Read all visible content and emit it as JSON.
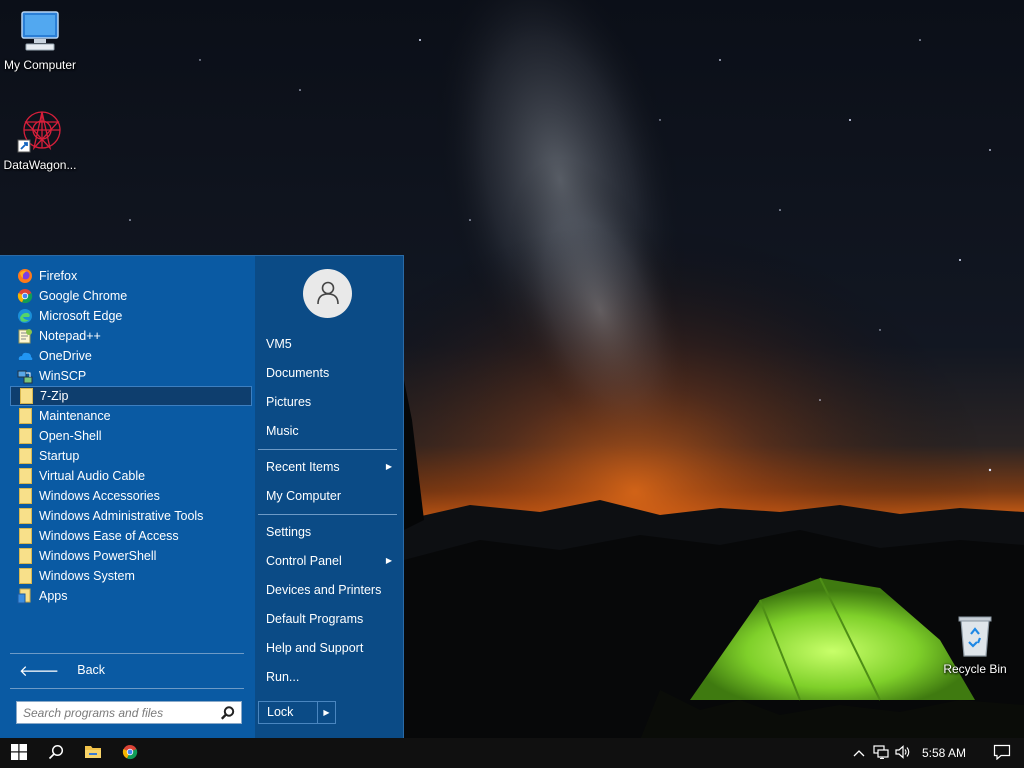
{
  "desktop": {
    "icons": [
      {
        "label": "My Computer",
        "icon": "computer-icon"
      },
      {
        "label": "DataWagon...",
        "icon": "datawagon-shortcut-icon"
      },
      {
        "label": "Recycle Bin",
        "icon": "recycle-bin-icon"
      }
    ]
  },
  "start_menu": {
    "programs": [
      {
        "label": "Firefox",
        "icon": "firefox-icon"
      },
      {
        "label": "Google Chrome",
        "icon": "chrome-icon"
      },
      {
        "label": "Microsoft Edge",
        "icon": "edge-icon"
      },
      {
        "label": "Notepad++",
        "icon": "notepadpp-icon"
      },
      {
        "label": "OneDrive",
        "icon": "onedrive-icon"
      },
      {
        "label": "WinSCP",
        "icon": "winscp-icon"
      },
      {
        "label": "7-Zip",
        "icon": "folder-icon",
        "selected": true
      },
      {
        "label": "Maintenance",
        "icon": "folder-icon"
      },
      {
        "label": "Open-Shell",
        "icon": "folder-icon"
      },
      {
        "label": "Startup",
        "icon": "folder-icon"
      },
      {
        "label": "Virtual Audio Cable",
        "icon": "folder-icon"
      },
      {
        "label": "Windows Accessories",
        "icon": "folder-icon"
      },
      {
        "label": "Windows Administrative Tools",
        "icon": "folder-icon"
      },
      {
        "label": "Windows Ease of Access",
        "icon": "folder-icon"
      },
      {
        "label": "Windows PowerShell",
        "icon": "folder-icon"
      },
      {
        "label": "Windows System",
        "icon": "folder-icon"
      },
      {
        "label": "Apps",
        "icon": "apps-icon"
      }
    ],
    "back_label": "Back",
    "search_placeholder": "Search programs and files",
    "places": [
      {
        "label": "VM5"
      },
      {
        "label": "Documents"
      },
      {
        "label": "Pictures"
      },
      {
        "label": "Music"
      },
      {
        "label": "Recent Items",
        "submenu": true
      },
      {
        "label": "My Computer"
      },
      {
        "label": "Settings"
      },
      {
        "label": "Control Panel",
        "submenu": true
      },
      {
        "label": "Devices and Printers"
      },
      {
        "label": "Default Programs"
      },
      {
        "label": "Help and Support"
      },
      {
        "label": "Run..."
      }
    ],
    "lock_label": "Lock",
    "arrow_glyph": "▶",
    "back_glyph": "🡐"
  },
  "taskbar": {
    "clock": "5:58 AM"
  },
  "colors": {
    "menu_left": "#0a5aa3",
    "menu_right": "#0b4b86",
    "taskbar": "#101010",
    "tent_green": "#8fe83a"
  }
}
